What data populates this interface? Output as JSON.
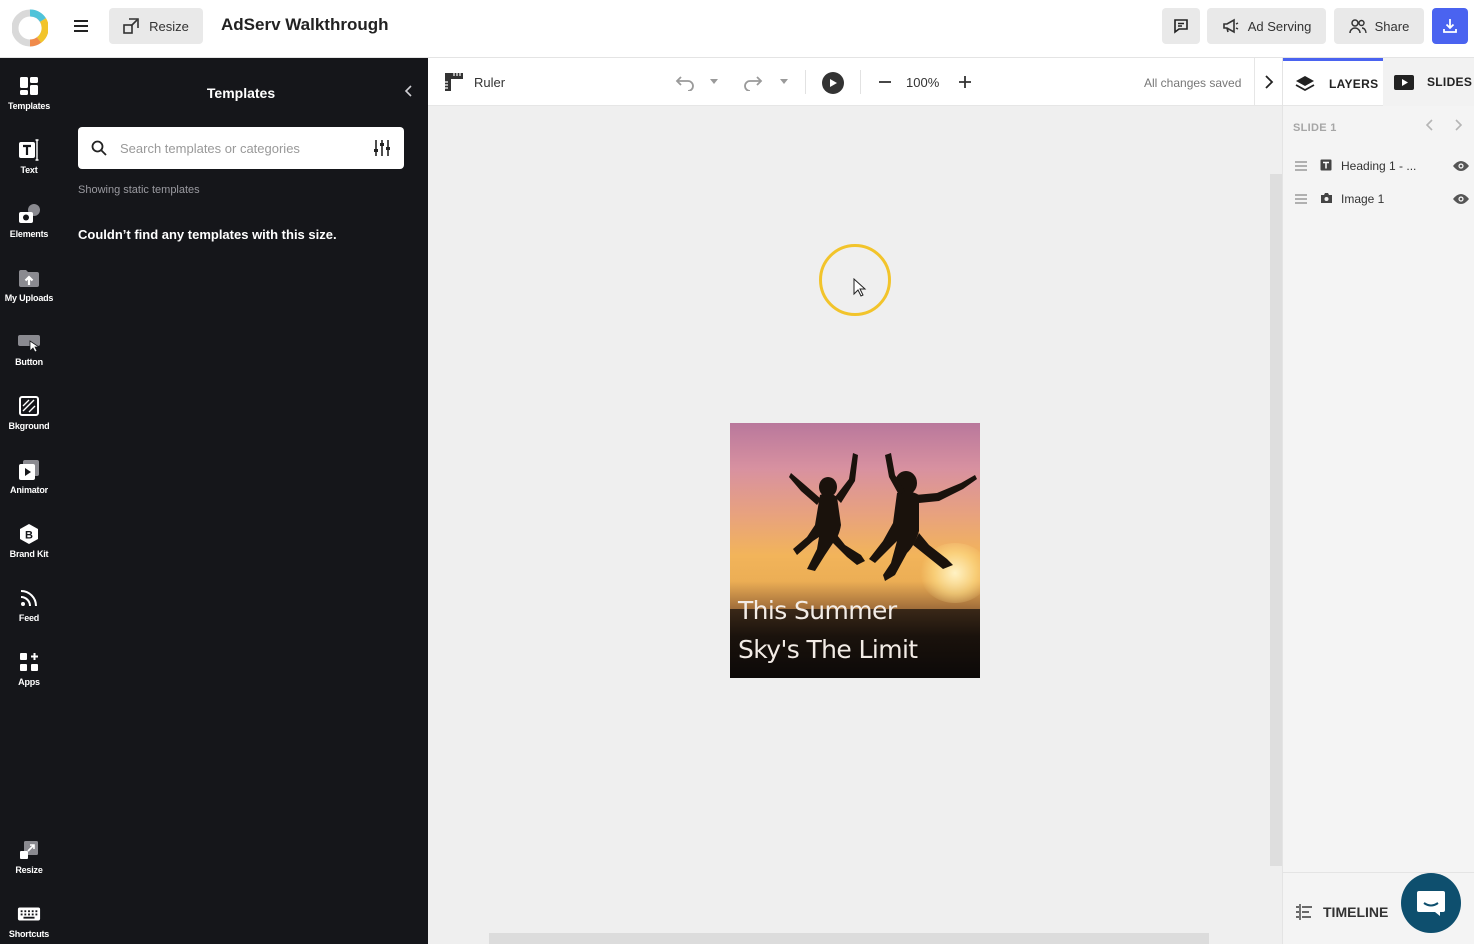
{
  "header": {
    "resize_label": "Resize",
    "title": "AdServ Walkthrough",
    "ad_serving_label": "Ad Serving",
    "share_label": "Share",
    "accent": "#4a63f0"
  },
  "rail": {
    "items": [
      {
        "label": "Templates",
        "icon": "templates-icon"
      },
      {
        "label": "Text",
        "icon": "text-icon"
      },
      {
        "label": "Elements",
        "icon": "elements-icon"
      },
      {
        "label": "My Uploads",
        "icon": "uploads-icon"
      },
      {
        "label": "Button",
        "icon": "button-icon"
      },
      {
        "label": "Bkground",
        "icon": "background-icon"
      },
      {
        "label": "Animator",
        "icon": "animator-icon"
      },
      {
        "label": "Brand Kit",
        "icon": "brand-kit-icon"
      },
      {
        "label": "Feed",
        "icon": "feed-icon"
      },
      {
        "label": "Apps",
        "icon": "apps-icon"
      }
    ],
    "bottom_items": [
      {
        "label": "Resize",
        "icon": "resize-icon"
      },
      {
        "label": "Shortcuts",
        "icon": "keyboard-icon"
      }
    ]
  },
  "templates_panel": {
    "title": "Templates",
    "search_placeholder": "Search templates or categories",
    "note": "Showing static templates",
    "empty_message": "Couldn’t find any templates with this size."
  },
  "toolbar": {
    "ruler_label": "Ruler",
    "zoom": "100%",
    "save_status": "All changes saved"
  },
  "artboard": {
    "heading_line1": "This Summer",
    "heading_line2": "Sky's The Limit"
  },
  "right_panel": {
    "tabs": [
      {
        "label": "LAYERS",
        "active": true
      },
      {
        "label": "SLIDES",
        "active": false
      }
    ],
    "slide_label": "SLIDE 1",
    "layers": [
      {
        "name": "Heading 1 - ...",
        "type": "text"
      },
      {
        "name": "Image 1",
        "type": "image"
      }
    ],
    "timeline_label": "TIMELINE"
  }
}
